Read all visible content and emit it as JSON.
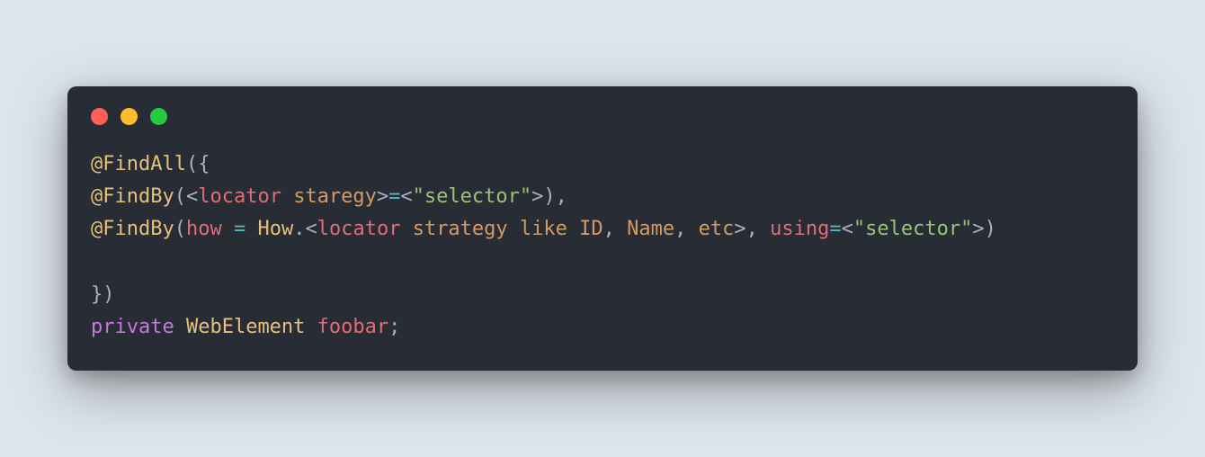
{
  "code": {
    "line1": {
      "at": "@",
      "anno": "FindAll",
      "open": "({"
    },
    "line2": {
      "at": "@",
      "anno": "FindBy",
      "open": "(",
      "lt1": "<",
      "locStrat": "locator",
      "staregy": " staregy",
      "gt1": ">",
      "eq1": "=",
      "lt2": "<",
      "q1": "\"selector\"",
      "gt2": ">",
      "close": "),"
    },
    "line3": {
      "at": "@",
      "anno": "FindBy",
      "open": "(",
      "how": "how",
      "sp1": " ",
      "eq1": "=",
      "sp2": " ",
      "howClass": "How",
      "dot": ".",
      "lt1": "<",
      "locator": "locator",
      "strategy": " strategy",
      "like": " like",
      "id": " ID",
      "comma1": ",",
      "name": " Name",
      "comma2": ",",
      "etc": " etc",
      "gt1": ">",
      "commaOut": ",",
      "sp3": " ",
      "using": "using",
      "eq2": "=",
      "lt2": "<",
      "sel": "\"selector\"",
      "gt2": ">",
      "close": ")"
    },
    "line5": {
      "text": "})"
    },
    "line6": {
      "kw": "private",
      "sp": " ",
      "type": "WebElement",
      "sp2": " ",
      "ident": "foobar",
      "semi": ";"
    }
  }
}
